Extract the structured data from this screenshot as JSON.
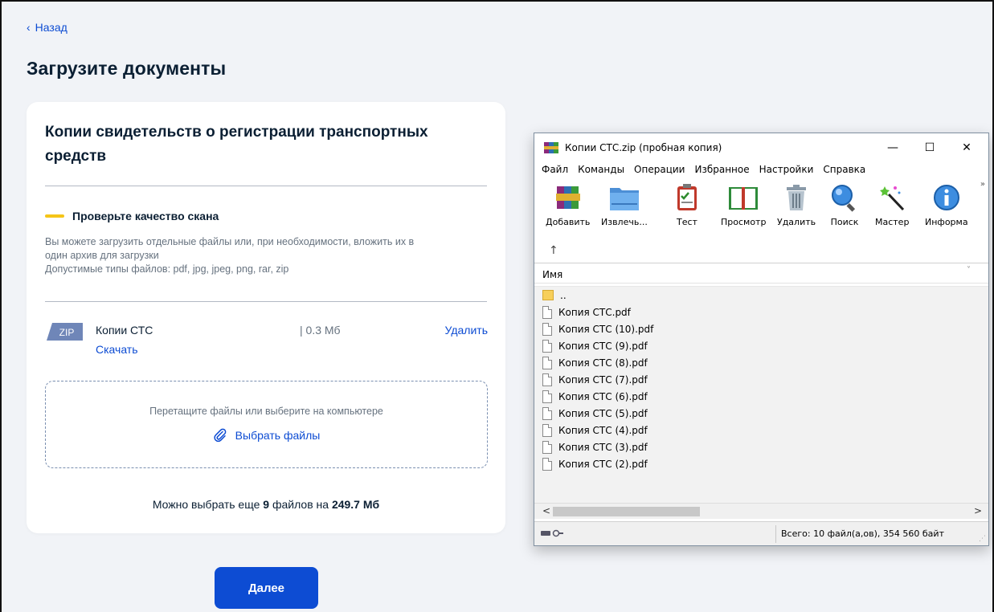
{
  "nav": {
    "back_icon": "‹",
    "back_label": "Назад"
  },
  "page": {
    "title": "Загрузите документы"
  },
  "card": {
    "title": "Копии свидетельств о регистрации транспортных средств",
    "warning_title": "Проверьте качество скана",
    "hint_line1": "Вы можете загрузить отдельные файлы или, при необходимости, вложить их в",
    "hint_line2": "один архив для загрузки",
    "hint_line3": "Допустимые типы файлов: pdf, jpg, jpeg, png, rar, zip",
    "file": {
      "badge": "ZIP",
      "name": "Копии СТС",
      "size": "| 0.3 Мб",
      "download_label": "Скачать",
      "delete_label": "Удалить"
    },
    "dropzone": {
      "text": "Перетащите файлы или выберите на компьютере",
      "button_label": "Выбрать файлы"
    },
    "limit": {
      "prefix": "Можно выбрать еще ",
      "count": "9",
      "middle": " файлов на ",
      "size": "249.7 Мб"
    }
  },
  "next_button": "Далее",
  "winrar": {
    "title": "Копии СТС.zip (пробная копия)",
    "controls": {
      "min": "—",
      "max": "☐",
      "close": "✕"
    },
    "menu": [
      "Файл",
      "Команды",
      "Операции",
      "Избранное",
      "Настройки",
      "Справка"
    ],
    "toolbar": [
      {
        "label": "Добавить",
        "icon": "add-archive-icon"
      },
      {
        "label": "Извлечь...",
        "icon": "extract-folder-icon"
      },
      {
        "label": "Тест",
        "icon": "test-clipboard-icon"
      },
      {
        "label": "Просмотр",
        "icon": "view-book-icon"
      },
      {
        "label": "Удалить",
        "icon": "trash-icon"
      },
      {
        "label": "Поиск",
        "icon": "search-icon"
      },
      {
        "label": "Мастер",
        "icon": "wizard-wand-icon"
      },
      {
        "label": "Информа",
        "icon": "info-icon"
      }
    ],
    "toolbar_more": "»",
    "up_icon": "↑",
    "column_header": "Имя",
    "column_chevron": "˅",
    "files": [
      {
        "name": "..",
        "type": "folder"
      },
      {
        "name": "Копия СТС.pdf",
        "type": "file"
      },
      {
        "name": "Копия СТС (10).pdf",
        "type": "file"
      },
      {
        "name": "Копия СТС (9).pdf",
        "type": "file"
      },
      {
        "name": "Копия СТС (8).pdf",
        "type": "file"
      },
      {
        "name": "Копия СТС (7).pdf",
        "type": "file"
      },
      {
        "name": "Копия СТС (6).pdf",
        "type": "file"
      },
      {
        "name": "Копия СТС (5).pdf",
        "type": "file"
      },
      {
        "name": "Копия СТС (4).pdf",
        "type": "file"
      },
      {
        "name": "Копия СТС (3).pdf",
        "type": "file"
      },
      {
        "name": "Копия СТС (2).pdf",
        "type": "file"
      }
    ],
    "scroll_left": "<",
    "scroll_right": ">",
    "status": "Всего: 10 файл(а,ов), 354 560 байт",
    "grip": "⋰"
  },
  "colors": {
    "accent": "#0d4cd3",
    "warning": "#f5c518",
    "background": "#f1f3f7",
    "zip_badge": "#6f86b8"
  }
}
